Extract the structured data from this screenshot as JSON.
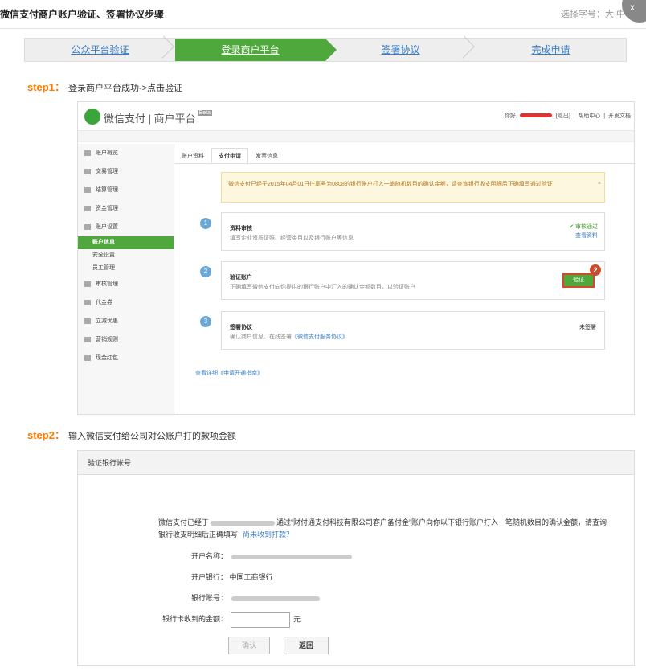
{
  "header": {
    "title": "微信支付商户账户验证、签署协议步骤",
    "font_size_label": "选择字号：大 中 小",
    "close": "x"
  },
  "steps": [
    "公众平台验证",
    "登录商户平台",
    "签署协议",
    "完成申请"
  ],
  "step1": {
    "label": "step1：",
    "desc": "登录商户平台成功->点击验证"
  },
  "step2": {
    "label": "step2：",
    "desc": "输入微信支付给公司对公账户打的款项金额"
  },
  "wx": {
    "brand": "微信支付 | 商户平台",
    "beta": "Beta",
    "greeting": "你好,",
    "logout": "[退出]",
    "help": "帮助中心",
    "dev_docs": "开发文档",
    "sidebar": [
      {
        "label": "账户概览"
      },
      {
        "label": "交易管理"
      },
      {
        "label": "结算管理"
      },
      {
        "label": "资金管理"
      },
      {
        "label": "账户设置"
      },
      {
        "label": "账户信息",
        "sub": true,
        "on": true
      },
      {
        "label": "安全设置",
        "sub": true
      },
      {
        "label": "员工管理",
        "sub": true
      },
      {
        "label": "审核管理"
      },
      {
        "label": "代金券"
      },
      {
        "label": "立减优惠"
      },
      {
        "label": "营销规则"
      },
      {
        "label": "现金红包"
      }
    ],
    "tabs": [
      "账户资料",
      "支付申请",
      "发票信息"
    ],
    "notice": "微信支付已经于2015年04月01日往尾号为0808的银行账户打入一笔随机数目的确认金额，请查询银行收支明细后正确填写通过验证",
    "notice_close": "×",
    "cards": [
      {
        "num": "1",
        "title": "资料审核",
        "desc": "填写企业资质证照、经营类目以及银行账户等信息",
        "status": "审核通过",
        "link": "查看资料"
      },
      {
        "num": "2",
        "title": "验证账户",
        "desc": "正确填写微信支付向你提供的银行账户中汇入的确认金额数目，以验证账户",
        "button": "验证",
        "badge": "2"
      },
      {
        "num": "3",
        "title": "签署协议",
        "desc": "确认商户信息、在线签署",
        "desc_link": "《微信支付服务协议》",
        "status": "未签署"
      }
    ],
    "guide": "查看详细《申请开通指南》"
  },
  "verify": {
    "title": "验证银行帐号",
    "text_a": "微信支付已经于",
    "text_b": "通过“财付通支付科技有限公司客户备付金”账户向你以下银行账户打入一笔随机数目的确认金额，请查询银行收支明细后正确填写",
    "not_received": "尚未收到打款？",
    "account_name_label": "开户名称：",
    "bank_label": "开户银行：",
    "bank_value": "中国工商银行",
    "account_no_label": "银行账号：",
    "amount_label": "银行卡收到的金额：",
    "unit": "元",
    "confirm": "确认",
    "back": "返回"
  }
}
